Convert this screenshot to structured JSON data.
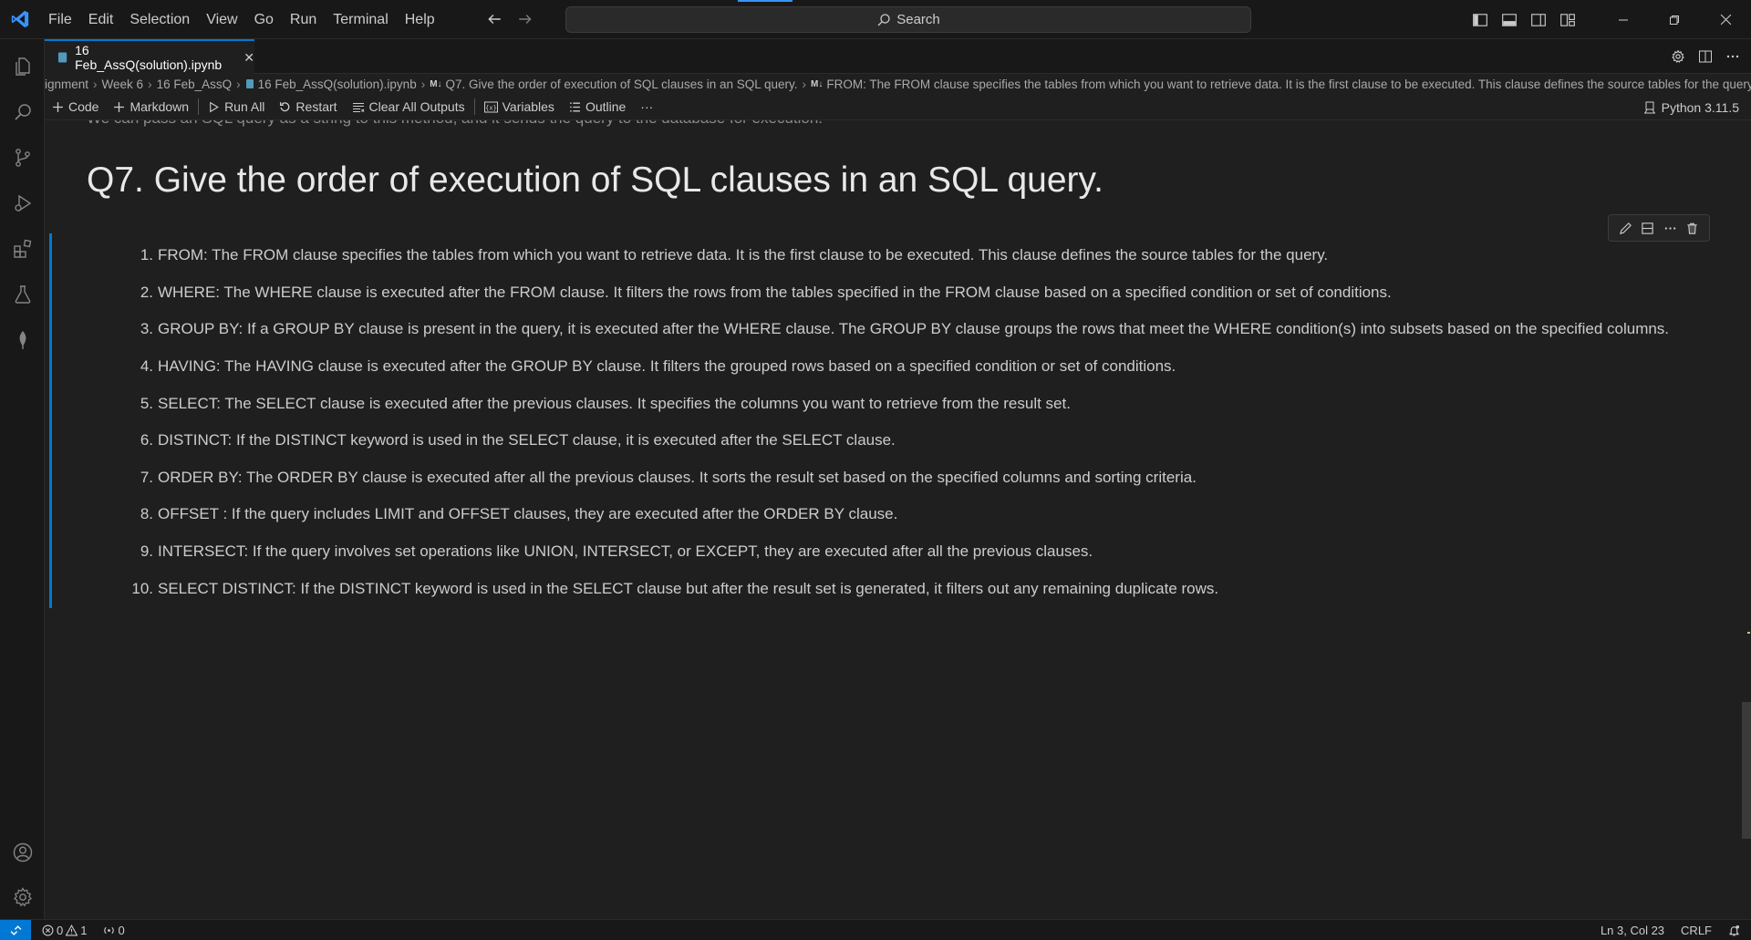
{
  "menu": [
    "File",
    "Edit",
    "Selection",
    "View",
    "Go",
    "Run",
    "Terminal",
    "Help"
  ],
  "search": {
    "label": "Search"
  },
  "tab": {
    "label": "16 Feb_AssQ(solution).ipynb",
    "close": "✕"
  },
  "breadcrumb": {
    "items": [
      "ignment",
      "Week 6",
      "16 Feb_AssQ",
      "16 Feb_AssQ(solution).ipynb"
    ],
    "md_badge": "M↓",
    "heading_item": "Q7. Give the order of execution of SQL clauses in an SQL query.",
    "content_item": "FROM: The FROM clause specifies the tables from which you want to retrieve data. It is the first clause to be executed. This clause defines the source tables for the query."
  },
  "toolbar": {
    "code": "Code",
    "markdown": "Markdown",
    "run_all": "Run All",
    "restart": "Restart",
    "clear": "Clear All Outputs",
    "variables": "Variables",
    "outline": "Outline",
    "more": "···",
    "kernel": "Python 3.11.5"
  },
  "editor": {
    "cut_text": "We can pass an SQL query as a string to this method, and it sends the query to the database for execution.",
    "heading": "Q7. Give the order of execution of SQL clauses in an SQL query.",
    "items": [
      "FROM: The FROM clause specifies the tables from which you want to retrieve data. It is the first clause to be executed. This clause defines the source tables for the query.",
      "WHERE: The WHERE clause is executed after the FROM clause. It filters the rows from the tables specified in the FROM clause based on a specified condition or set of conditions.",
      "GROUP BY: If a GROUP BY clause is present in the query, it is executed after the WHERE clause. The GROUP BY clause groups the rows that meet the WHERE condition(s) into subsets based on the specified columns.",
      "HAVING: The HAVING clause is executed after the GROUP BY clause. It filters the grouped rows based on a specified condition or set of conditions.",
      "SELECT: The SELECT clause is executed after the previous clauses. It specifies the columns you want to retrieve from the result set.",
      "DISTINCT: If the DISTINCT keyword is used in the SELECT clause, it is executed after the SELECT clause.",
      "ORDER BY: The ORDER BY clause is executed after all the previous clauses. It sorts the result set based on the specified columns and sorting criteria.",
      "OFFSET : If the query includes LIMIT and OFFSET clauses, they are executed after the ORDER BY clause.",
      "INTERSECT: If the query involves set operations like UNION, INTERSECT, or EXCEPT, they are executed after all the previous clauses.",
      "SELECT DISTINCT: If the DISTINCT keyword is used in the SELECT clause but after the result set is generated, it filters out any remaining duplicate rows."
    ],
    "numbers": [
      "1.",
      "2.",
      "3.",
      "4.",
      "5.",
      "6.",
      "7.",
      "8.",
      "9.",
      "10."
    ]
  },
  "status": {
    "errors": "0",
    "warnings": "1",
    "ports": "0",
    "position": "Ln 3, Col 23",
    "eol": "CRLF"
  },
  "colors": {
    "accent": "#0078d4",
    "background": "#1f1f1f",
    "chrome": "#181818"
  }
}
